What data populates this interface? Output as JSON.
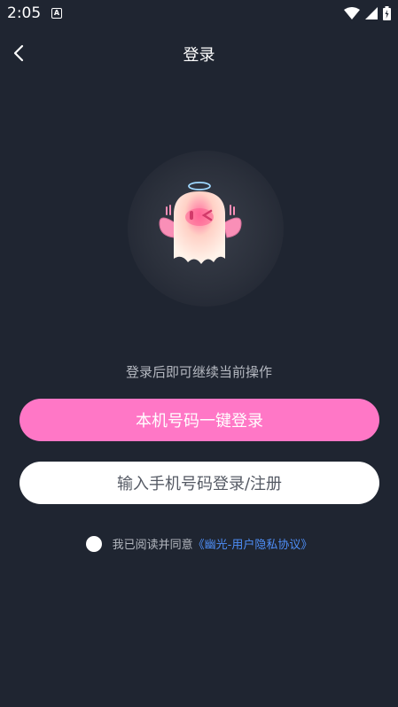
{
  "status_bar": {
    "time": "2:05",
    "notification_icon": "A"
  },
  "header": {
    "title": "登录",
    "back_icon": "chevron-left-icon"
  },
  "mascot": {
    "icon": "ghost-angel-icon"
  },
  "hint_text": "登录后即可继续当前操作",
  "primary_button": {
    "label": "本机号码一键登录",
    "color": "#ff77c6"
  },
  "secondary_button": {
    "label": "输入手机号码登录/注册"
  },
  "agreement": {
    "prefix": "我已阅读并同意",
    "link": "《幽光-用户隐私协议》",
    "link_color": "#4e8ef7"
  },
  "colors": {
    "background": "#1f2531"
  }
}
